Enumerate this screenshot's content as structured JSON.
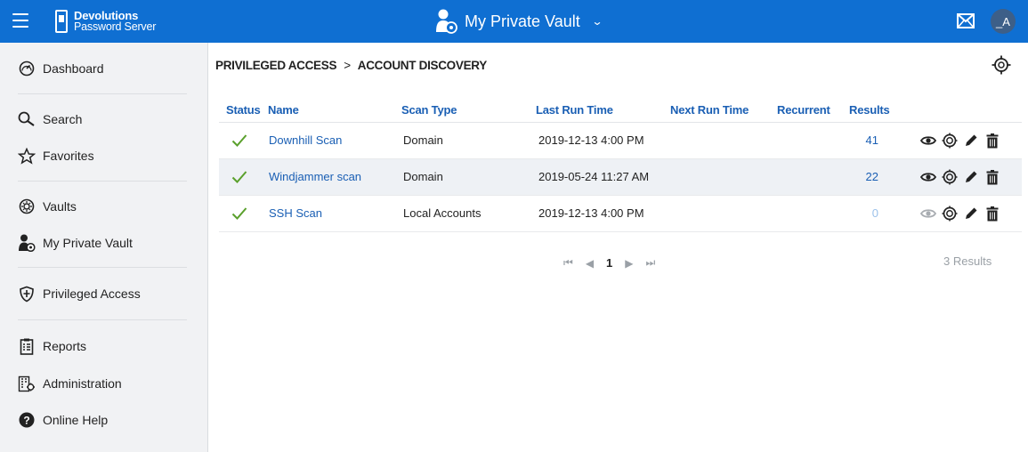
{
  "header": {
    "logo_line1": "Devolutions",
    "logo_line2": "Password Server",
    "vault_title": "My Private Vault",
    "chevron": "⌄",
    "avatar_initials": "_A",
    "colors": {
      "bar": "#0f6fd2",
      "avatar": "#3d5f88"
    }
  },
  "sidebar": {
    "items": [
      {
        "label": "Dashboard",
        "icon": "dashboard-gauge-icon"
      },
      {
        "label": "Search",
        "icon": "search-icon"
      },
      {
        "label": "Favorites",
        "icon": "star-icon"
      },
      {
        "label": "Vaults",
        "icon": "vault-icon"
      },
      {
        "label": "My Private Vault",
        "icon": "private-vault-user-icon"
      },
      {
        "label": "Privileged Access",
        "icon": "shield-icon"
      },
      {
        "label": "Reports",
        "icon": "report-icon"
      },
      {
        "label": "Administration",
        "icon": "administration-icon"
      },
      {
        "label": "Online Help",
        "icon": "help-icon"
      }
    ]
  },
  "breadcrumb": {
    "parent": "PRIVILEGED ACCESS",
    "separator": ">",
    "current": "ACCOUNT DISCOVERY"
  },
  "table": {
    "columns": [
      "Status",
      "Name",
      "Scan Type",
      "Last Run Time",
      "Next Run Time",
      "Recurrent",
      "Results"
    ],
    "rows": [
      {
        "status": "success",
        "name": "Downhill Scan",
        "scan_type": "Domain",
        "last_run": "2019-12-13 4:00 PM",
        "next_run": "",
        "recurrent": "",
        "results": "41"
      },
      {
        "status": "success",
        "name": "Windjammer scan",
        "scan_type": "Domain",
        "last_run": "2019-05-24 11:27 AM",
        "next_run": "",
        "recurrent": "",
        "results": "22"
      },
      {
        "status": "success",
        "name": "SSH Scan",
        "scan_type": "Local Accounts",
        "last_run": "2019-12-13 4:00 PM",
        "next_run": "",
        "recurrent": "",
        "results": "0"
      }
    ]
  },
  "pager": {
    "first": "⏮",
    "prev": "◀",
    "current_page": "1",
    "next": "▶",
    "last": "⏭",
    "results_label": "3 Results"
  }
}
